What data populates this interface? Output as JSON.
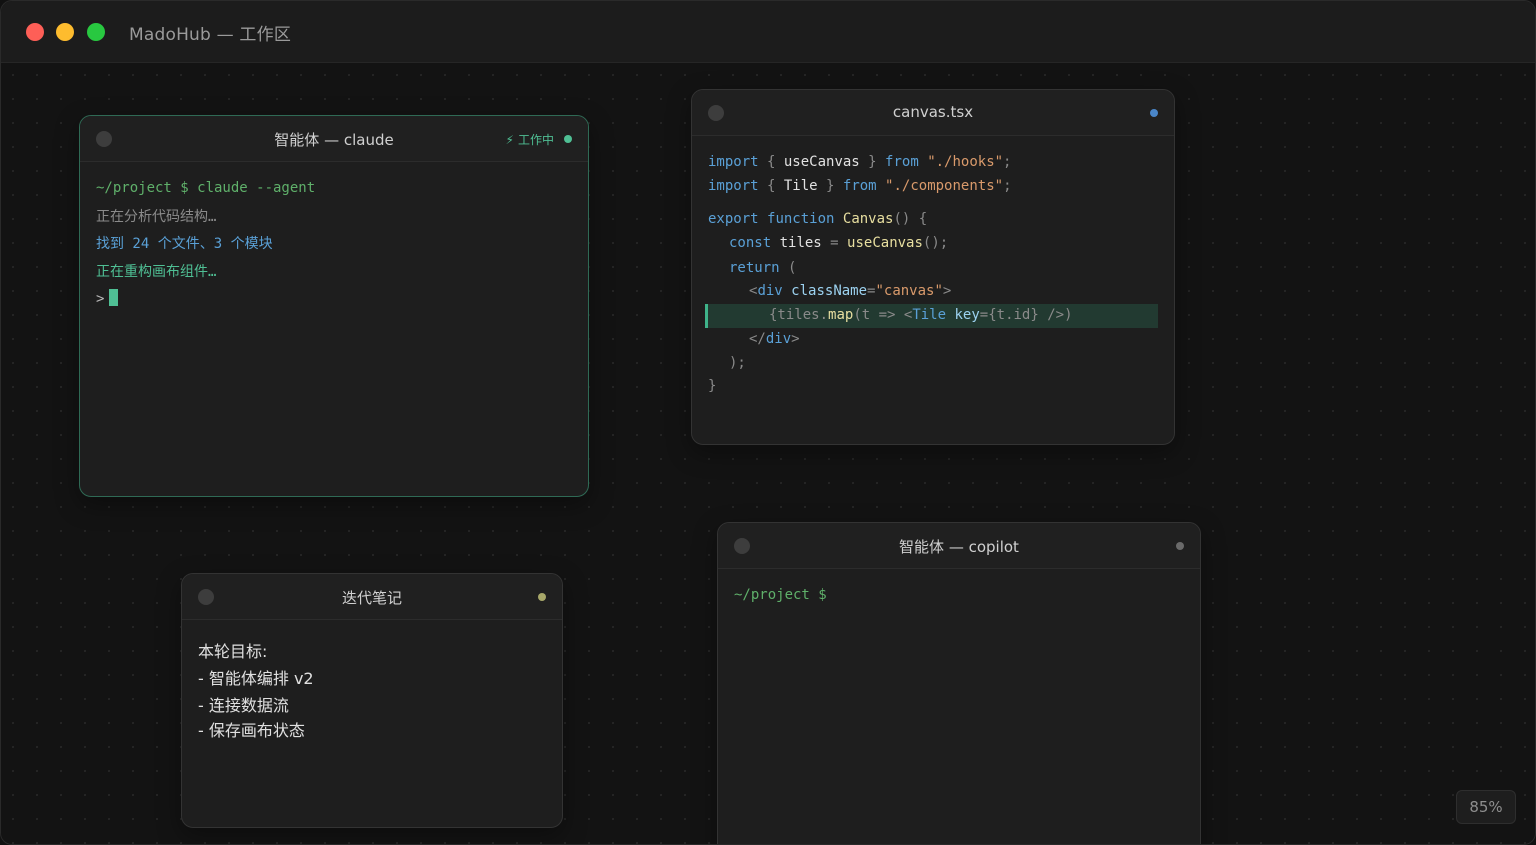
{
  "window": {
    "title": "MadoHub — 工作区"
  },
  "colors": {
    "accent": "#4fbf94",
    "blue_dot": "#4a86c8",
    "olive_dot": "#a8a86a",
    "gray_dot": "#6a6a6a"
  },
  "cards": {
    "claude": {
      "title": "智能体 — claude",
      "badge": "工作中",
      "badge_icon": "lightning-icon",
      "lines": {
        "cmd": "~/project $ claude --agent",
        "l1": "正在分析代码结构…",
        "l2": "找到 24 个文件、3 个模块",
        "l3": "正在重构画布组件…",
        "prompt": ">"
      }
    },
    "editor": {
      "title": "canvas.tsx",
      "code": {
        "l1": [
          "import",
          " { ",
          "useCanvas",
          " } ",
          "from",
          " ",
          "\"./hooks\"",
          ";"
        ],
        "l2": [
          "import",
          " { ",
          "Tile",
          " } ",
          "from",
          " ",
          "\"./components\"",
          ";"
        ],
        "l3": [
          "export",
          " ",
          "function",
          " ",
          "Canvas",
          "() {"
        ],
        "l4": [
          "const",
          " ",
          "tiles",
          " = ",
          "useCanvas",
          "();"
        ],
        "l5": [
          "return",
          " ("
        ],
        "l6": [
          "<",
          "div",
          " ",
          "className",
          "=",
          "\"canvas\"",
          ">"
        ],
        "l7": [
          "{tiles.",
          "map",
          "(t => <",
          "Tile",
          " ",
          "key",
          "={t.id} />)"
        ],
        "l8": [
          "</",
          "div",
          ">"
        ],
        "l9": [
          ");"
        ],
        "l10": [
          "}"
        ]
      }
    },
    "notes": {
      "title": "迭代笔记",
      "lines": [
        "本轮目标:",
        "- 智能体编排 v2",
        "- 连接数据流",
        "- 保存画布状态"
      ]
    },
    "copilot": {
      "title": "智能体 — copilot",
      "prompt": "~/project $"
    }
  },
  "zoom": {
    "label": "85%"
  }
}
